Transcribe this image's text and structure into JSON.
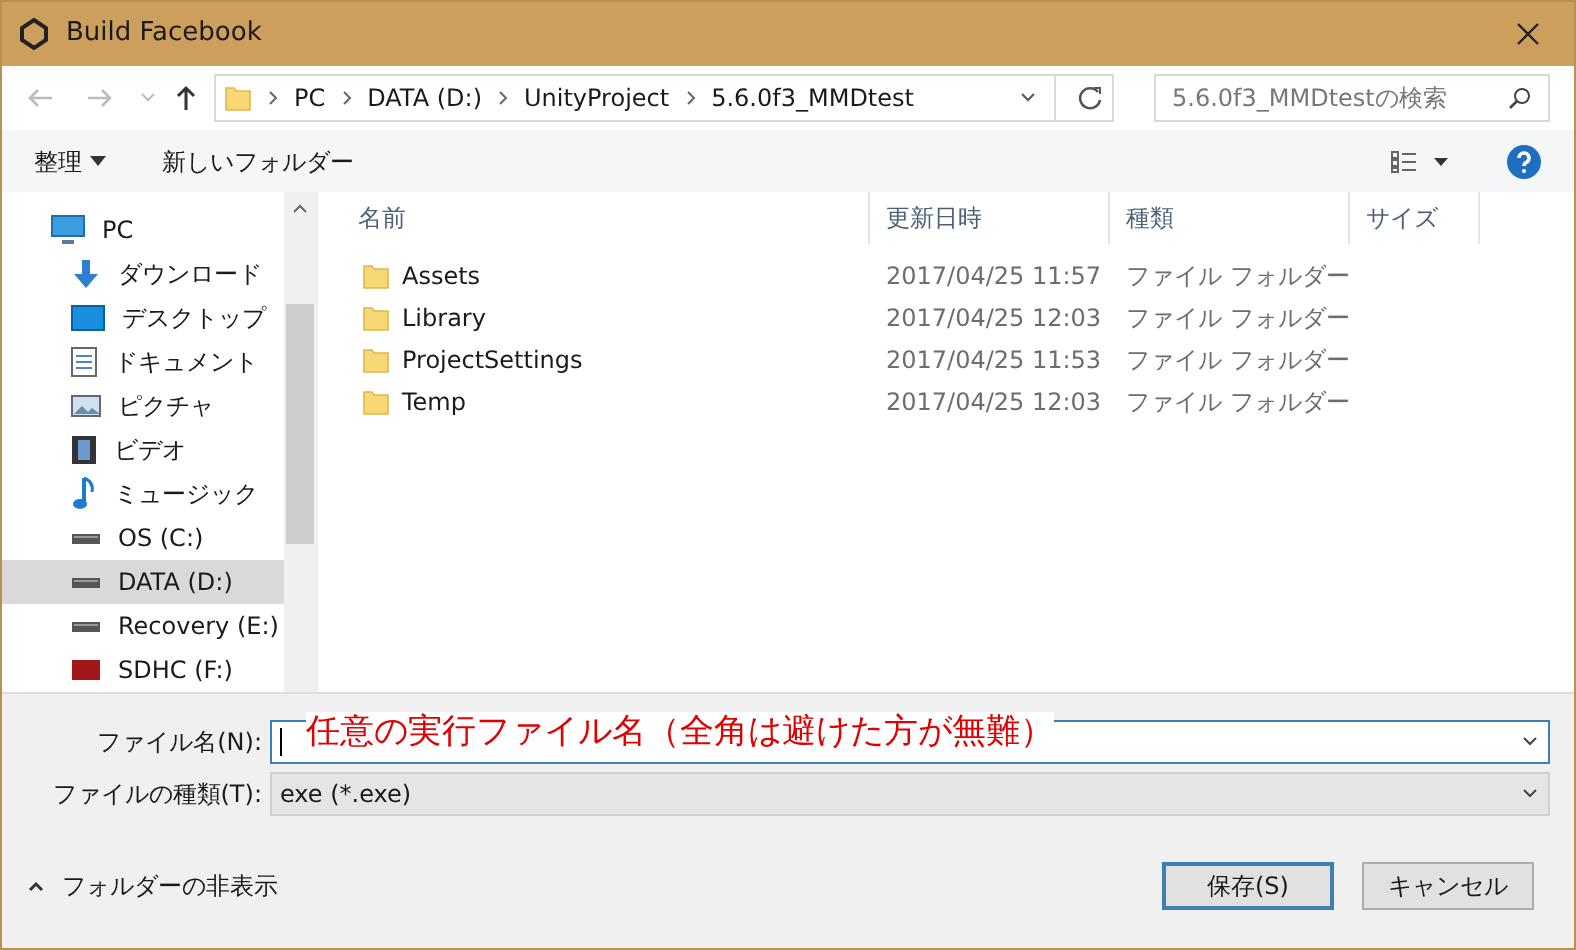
{
  "window": {
    "title": "Build Facebook"
  },
  "address": {
    "crumbs": [
      "PC",
      "DATA (D:)",
      "UnityProject",
      "5.6.0f3_MMDtest"
    ],
    "search_placeholder": "5.6.0f3_MMDtestの検索"
  },
  "toolbar": {
    "organize": "整理",
    "new_folder": "新しいフォルダー"
  },
  "sidebar": {
    "items": [
      {
        "label": "PC",
        "kind": "pc",
        "selected": false
      },
      {
        "label": "ダウンロード",
        "kind": "download",
        "selected": false
      },
      {
        "label": "デスクトップ",
        "kind": "desktop",
        "selected": false
      },
      {
        "label": "ドキュメント",
        "kind": "document",
        "selected": false
      },
      {
        "label": "ピクチャ",
        "kind": "picture",
        "selected": false
      },
      {
        "label": "ビデオ",
        "kind": "video",
        "selected": false
      },
      {
        "label": "ミュージック",
        "kind": "music",
        "selected": false
      },
      {
        "label": "OS (C:)",
        "kind": "drive",
        "selected": false
      },
      {
        "label": "DATA (D:)",
        "kind": "drive",
        "selected": true
      },
      {
        "label": "Recovery (E:)",
        "kind": "drive",
        "selected": false
      },
      {
        "label": "SDHC (F:)",
        "kind": "sd",
        "selected": false
      }
    ]
  },
  "table": {
    "columns": [
      "名前",
      "更新日時",
      "種類",
      "サイズ"
    ],
    "rows": [
      {
        "name": "Assets",
        "modified": "2017/04/25 11:57",
        "type": "ファイル フォルダー"
      },
      {
        "name": "Library",
        "modified": "2017/04/25 12:03",
        "type": "ファイル フォルダー"
      },
      {
        "name": "ProjectSettings",
        "modified": "2017/04/25 11:53",
        "type": "ファイル フォルダー"
      },
      {
        "name": "Temp",
        "modified": "2017/04/25 12:03",
        "type": "ファイル フォルダー"
      }
    ]
  },
  "form": {
    "filename_label": "ファイル名(N):",
    "annotation": "任意の実行ファイル名（全角は避けた方が無難）",
    "filetype_label": "ファイルの種類(T):",
    "filetype_value": "exe (*.exe)"
  },
  "footer": {
    "hide_folders": "フォルダーの非表示",
    "save": "保存(S)",
    "cancel": "キャンセル"
  }
}
